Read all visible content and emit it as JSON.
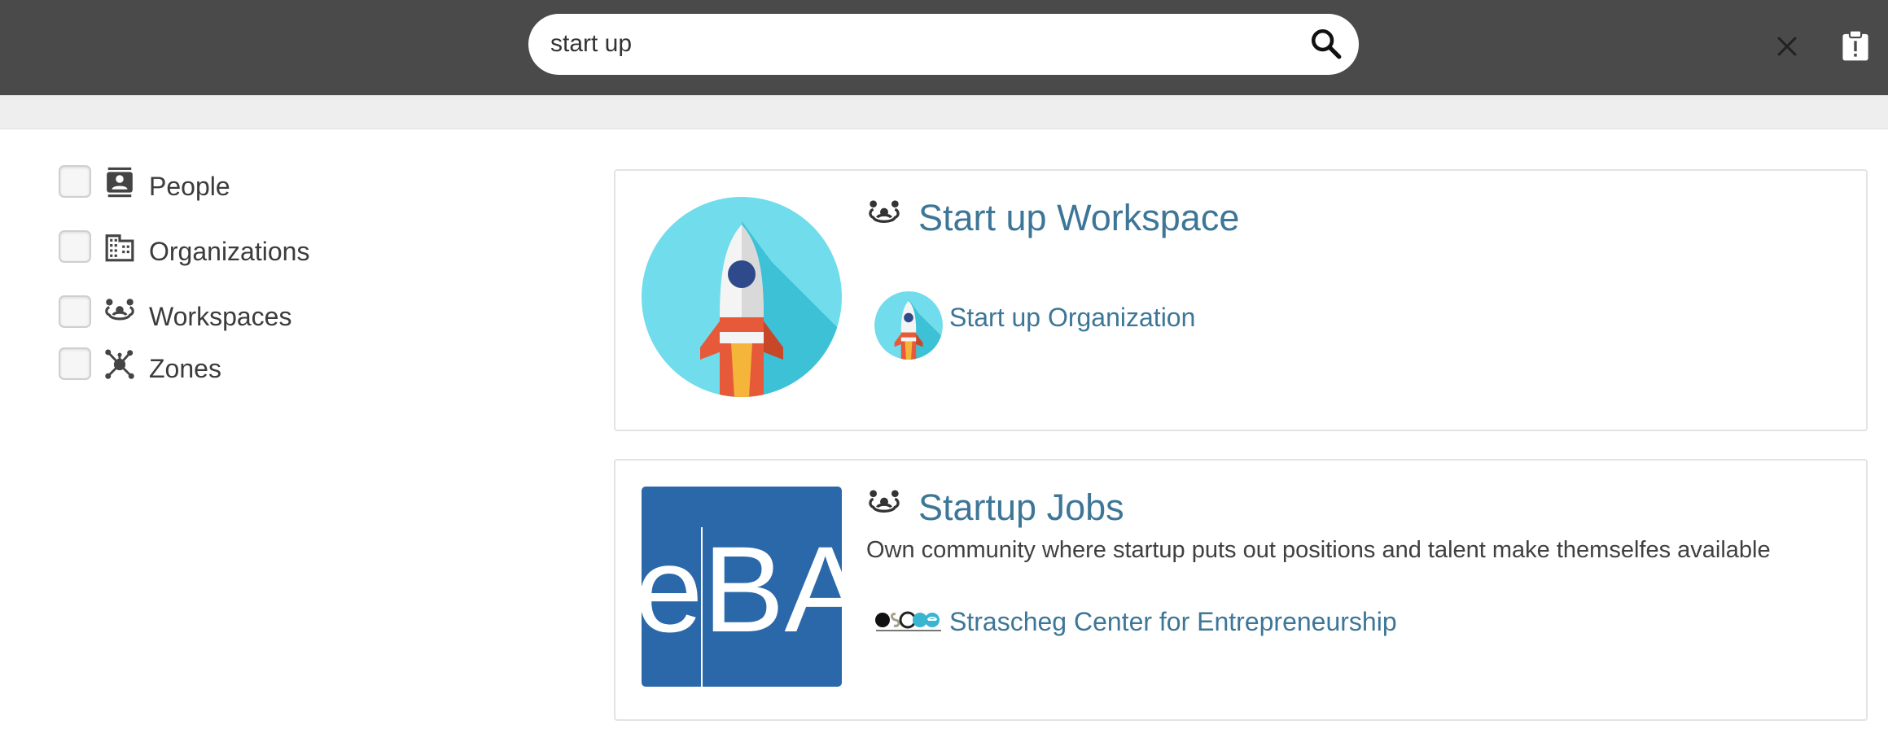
{
  "search": {
    "value": "start up",
    "clear_icon": "close-icon",
    "submit_icon": "search-icon"
  },
  "header": {
    "report_icon": "clipboard-alert-icon"
  },
  "filters": [
    {
      "label": "People",
      "icon": "contact-card-icon",
      "checked": false
    },
    {
      "label": "Organizations",
      "icon": "building-icon",
      "checked": false
    },
    {
      "label": "Workspaces",
      "icon": "workspace-group-icon",
      "checked": false
    },
    {
      "label": "Zones",
      "icon": "network-hub-icon",
      "checked": false
    }
  ],
  "results": [
    {
      "title": "Start up Workspace",
      "type_icon": "workspace-group-icon",
      "thumbnail": "rocket-image",
      "description": "",
      "organization": {
        "name": "Start up Organization",
        "logo": "rocket-image"
      }
    },
    {
      "title": "Startup Jobs",
      "type_icon": "workspace-group-icon",
      "thumbnail": "eba-logo-image",
      "thumbnail_text": "eBA",
      "description": "Own community where startup puts out positions and talent make themselfes available",
      "organization": {
        "name": "Strascheg Center for Entrepreneurship",
        "logo": "sce-logo-image"
      }
    }
  ],
  "colors": {
    "header_bg": "#4a4a4a",
    "link": "#3d7697",
    "rocket_bg": "#5fd3e6",
    "eba_bg": "#2b68aa"
  }
}
